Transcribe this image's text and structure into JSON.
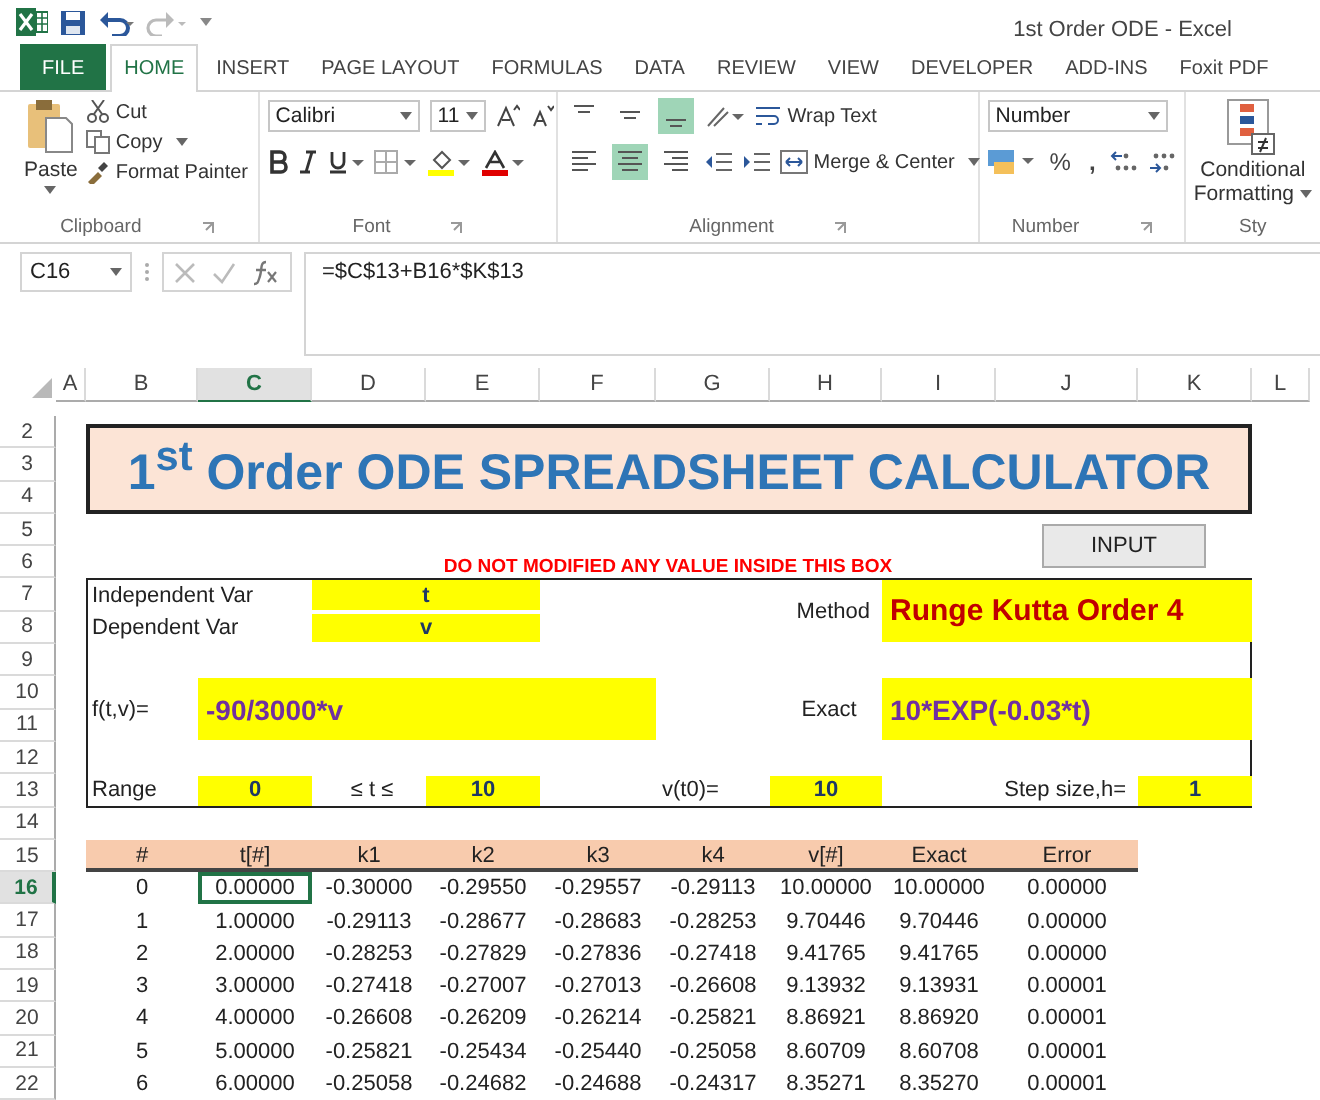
{
  "window": {
    "title": "1st Order ODE - Excel"
  },
  "tabs": [
    {
      "label": "FILE",
      "kind": "file",
      "selected": false
    },
    {
      "label": "HOME",
      "kind": "tab",
      "selected": true
    },
    {
      "label": "INSERT",
      "kind": "tab",
      "selected": false
    },
    {
      "label": "PAGE LAYOUT",
      "kind": "tab",
      "selected": false
    },
    {
      "label": "FORMULAS",
      "kind": "tab",
      "selected": false
    },
    {
      "label": "DATA",
      "kind": "tab",
      "selected": false
    },
    {
      "label": "REVIEW",
      "kind": "tab",
      "selected": false
    },
    {
      "label": "VIEW",
      "kind": "tab",
      "selected": false
    },
    {
      "label": "DEVELOPER",
      "kind": "tab",
      "selected": false
    },
    {
      "label": "ADD-INS",
      "kind": "tab",
      "selected": false
    },
    {
      "label": "Foxit PDF",
      "kind": "tab",
      "selected": false
    }
  ],
  "ribbon": {
    "clipboard": {
      "paste": "Paste",
      "cut": "Cut",
      "copy": "Copy",
      "format_painter": "Format Painter",
      "label": "Clipboard"
    },
    "font": {
      "name": "Calibri",
      "size": "11",
      "label": "Font"
    },
    "alignment": {
      "vertical": [
        {
          "selected": false
        },
        {
          "selected": false
        },
        {
          "selected": true
        }
      ],
      "horizontal": [
        {
          "selected": false
        },
        {
          "selected": true
        },
        {
          "selected": false
        }
      ],
      "wrap": "Wrap Text",
      "merge": "Merge & Center",
      "label": "Alignment"
    },
    "number": {
      "format": "Number",
      "percent": "%",
      "comma": ",",
      "label": "Number"
    },
    "styles": {
      "conditional_1": "Conditional",
      "conditional_2": "Formatting",
      "label": "Sty"
    }
  },
  "formula_bar": {
    "name_box": "C16",
    "formula": "=$C$13+B16*$K$13"
  },
  "sheet": {
    "columns": [
      {
        "label": "A",
        "selected": false
      },
      {
        "label": "B",
        "selected": false
      },
      {
        "label": "C",
        "selected": true
      },
      {
        "label": "D",
        "selected": false
      },
      {
        "label": "E",
        "selected": false
      },
      {
        "label": "F",
        "selected": false
      },
      {
        "label": "G",
        "selected": false
      },
      {
        "label": "H",
        "selected": false
      },
      {
        "label": "I",
        "selected": false
      },
      {
        "label": "J",
        "selected": false
      },
      {
        "label": "K",
        "selected": false
      },
      {
        "label": "L",
        "selected": false
      }
    ],
    "rows": [
      {
        "label": "2",
        "selected": false
      },
      {
        "label": "3",
        "selected": false
      },
      {
        "label": "4",
        "selected": false
      },
      {
        "label": "5",
        "selected": false
      },
      {
        "label": "6",
        "selected": false
      },
      {
        "label": "7",
        "selected": false
      },
      {
        "label": "8",
        "selected": false
      },
      {
        "label": "9",
        "selected": false
      },
      {
        "label": "10",
        "selected": false
      },
      {
        "label": "11",
        "selected": false
      },
      {
        "label": "12",
        "selected": false
      },
      {
        "label": "13",
        "selected": false
      },
      {
        "label": "14",
        "selected": false
      },
      {
        "label": "15",
        "selected": false
      },
      {
        "label": "16",
        "selected": true
      },
      {
        "label": "17",
        "selected": false
      },
      {
        "label": "18",
        "selected": false
      },
      {
        "label": "19",
        "selected": false
      },
      {
        "label": "20",
        "selected": false
      },
      {
        "label": "21",
        "selected": false
      },
      {
        "label": "22",
        "selected": false
      }
    ]
  },
  "title": "1$^{st}$ Order ODE SPREADSHEET CALCULATOR",
  "warning": "DO NOT MODIFIED ANY VALUE INSIDE THIS BOX",
  "input_button": "INPUT",
  "params": {
    "independent_label": "Independent Var",
    "independent_value": "t",
    "dependent_label": "Dependent Var",
    "dependent_value": "v",
    "method_label": "Method",
    "method_value": "Runge Kutta Order 4",
    "f_label": "f(t,v)=",
    "f_value": "-90/3000*v",
    "exact_label": "Exact",
    "exact_value": "10*EXP(-0.03*t)",
    "range_label": "Range",
    "range_from": "0",
    "range_op": "≤ t ≤",
    "range_to": "10",
    "v0_label": "v(t0)=",
    "v0_value": "10",
    "step_label": "Step size,h=",
    "step_value": "1"
  },
  "table": {
    "columns": [
      "#",
      "t[#]",
      "k1",
      "k2",
      "k3",
      "k4",
      "v[#]",
      "Exact",
      "Error"
    ],
    "rows": [
      [
        "0",
        "0.00000",
        "-0.30000",
        "-0.29550",
        "-0.29557",
        "-0.29113",
        "10.00000",
        "10.00000",
        "0.00000"
      ],
      [
        "1",
        "1.00000",
        "-0.29113",
        "-0.28677",
        "-0.28683",
        "-0.28253",
        "9.70446",
        "9.70446",
        "0.00000"
      ],
      [
        "2",
        "2.00000",
        "-0.28253",
        "-0.27829",
        "-0.27836",
        "-0.27418",
        "9.41765",
        "9.41765",
        "0.00000"
      ],
      [
        "3",
        "3.00000",
        "-0.27418",
        "-0.27007",
        "-0.27013",
        "-0.26608",
        "9.13932",
        "9.13931",
        "0.00001"
      ],
      [
        "4",
        "4.00000",
        "-0.26608",
        "-0.26209",
        "-0.26214",
        "-0.25821",
        "8.86921",
        "8.86920",
        "0.00001"
      ],
      [
        "5",
        "5.00000",
        "-0.25821",
        "-0.25434",
        "-0.25440",
        "-0.25058",
        "8.60709",
        "8.60708",
        "0.00001"
      ],
      [
        "6",
        "6.00000",
        "-0.25058",
        "-0.24682",
        "-0.24688",
        "-0.24317",
        "8.35271",
        "8.35270",
        "0.00001"
      ]
    ]
  }
}
